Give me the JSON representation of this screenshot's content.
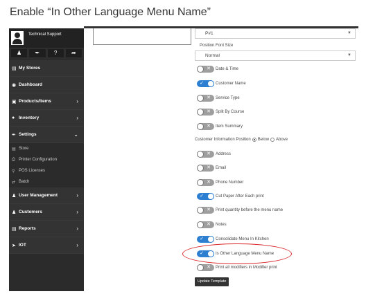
{
  "heading": "Enable “In Other Language Menu Name”",
  "profile": {
    "name": "Technical Support",
    "icons": [
      "user-icon",
      "brush-icon",
      "help-icon",
      "logout-icon"
    ]
  },
  "nav": {
    "my_stores": "My Stores",
    "dashboard": "Dashboard",
    "products": "Products/Items",
    "inventory": "Inventory",
    "settings": "Settings",
    "settings_sub": [
      "Store",
      "Printer Configuration",
      "POS Licenses",
      "Batch"
    ],
    "user_management": "User Management",
    "customers": "Customers",
    "reports": "Reports",
    "iot": "IOT"
  },
  "form": {
    "position_select": "P#1",
    "font_size_label": "Position Font Size",
    "font_size_value": "Normal",
    "toggles": [
      {
        "label": "Date & Time",
        "on": false
      },
      {
        "label": "Customer Name",
        "on": true
      },
      {
        "label": "Service Type",
        "on": false
      },
      {
        "label": "Split By Course",
        "on": false
      },
      {
        "label": "Item Summary",
        "on": false
      }
    ],
    "customer_info_label": "Customer Information Position",
    "radio_below": "Below",
    "radio_above": "Above",
    "toggles2": [
      {
        "label": "Address",
        "on": false
      },
      {
        "label": "Email",
        "on": false
      },
      {
        "label": "Phone Number",
        "on": false
      },
      {
        "label": "Cut Paper After Each print",
        "on": true
      },
      {
        "label": "Print quantity before the menu name",
        "on": false
      },
      {
        "label": "Notes",
        "on": false
      },
      {
        "label": "Consolidate Menu In Kitchen",
        "on": true
      },
      {
        "label": "Is Other Language Menu Name",
        "on": true
      },
      {
        "label": "Print all modifiers in Modifier print",
        "on": false
      }
    ],
    "update_button": "Update Template"
  },
  "colors": {
    "toggle_on": "#2d7fd1",
    "toggle_off": "#9e9e9e",
    "highlight": "#d9262a",
    "sidebar": "#2b2b2b"
  }
}
